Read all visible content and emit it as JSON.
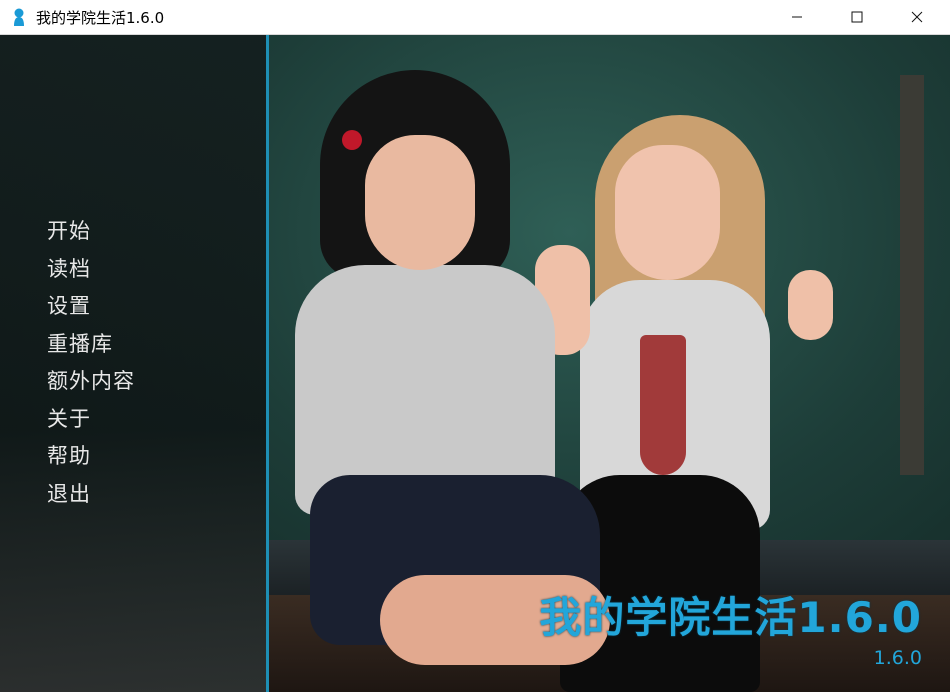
{
  "window": {
    "title": "我的学院生活1.6.0",
    "controls": [
      "minimize",
      "maximize",
      "close"
    ]
  },
  "menu": {
    "items": [
      {
        "label": "开始"
      },
      {
        "label": "读档"
      },
      {
        "label": "设置"
      },
      {
        "label": "重播库"
      },
      {
        "label": "额外内容"
      },
      {
        "label": "关于"
      },
      {
        "label": "帮助"
      },
      {
        "label": "退出"
      }
    ]
  },
  "logo": {
    "title": "我的学院生活1.6.0",
    "version": "1.6.0"
  },
  "colors": {
    "accent": "#22a6da",
    "panel_edge": "#1e8fb5"
  },
  "icons": {
    "app": "app-icon",
    "minimize": "minimize-icon",
    "maximize": "maximize-icon",
    "close": "close-icon"
  }
}
